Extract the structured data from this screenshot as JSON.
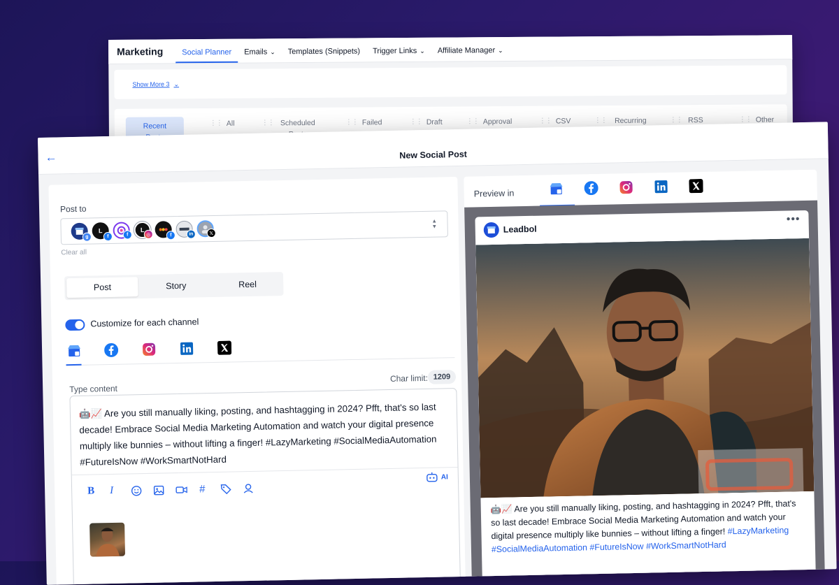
{
  "marketing": {
    "brand": "Marketing",
    "nav": [
      {
        "label": "Social Planner",
        "active": true,
        "dropdown": false
      },
      {
        "label": "Emails",
        "active": false,
        "dropdown": true
      },
      {
        "label": "Templates (Snippets)",
        "active": false,
        "dropdown": false
      },
      {
        "label": "Trigger Links",
        "active": false,
        "dropdown": true
      },
      {
        "label": "Affiliate Manager",
        "active": false,
        "dropdown": true
      }
    ],
    "show_more": "Show More 3",
    "post_tabs": [
      {
        "label": "Recent Posts",
        "active": true
      },
      {
        "label": "All",
        "active": false
      },
      {
        "label": "Scheduled Posts",
        "active": false
      },
      {
        "label": "Failed",
        "active": false
      },
      {
        "label": "Draft",
        "active": false
      },
      {
        "label": "Approval",
        "active": false
      },
      {
        "label": "CSV",
        "active": false
      },
      {
        "label": "Recurring Posts",
        "active": false
      },
      {
        "label": "RSS Posts",
        "active": false
      },
      {
        "label": "Other",
        "active": false
      }
    ]
  },
  "new_post": {
    "title": "New Social Post",
    "post_to_label": "Post to",
    "clear_all": "Clear all",
    "accounts": [
      {
        "initial": "",
        "network": "google-business",
        "bg": "#1e3a8a"
      },
      {
        "initial": "L",
        "network": "facebook",
        "bg": "#111111"
      },
      {
        "initial": "",
        "network": "facebook",
        "bg": "#7c3aed"
      },
      {
        "initial": "L",
        "network": "instagram",
        "bg": "#111111"
      },
      {
        "initial": "",
        "network": "facebook",
        "bg": "#111111"
      },
      {
        "initial": "",
        "network": "linkedin",
        "bg": "#e5e7eb"
      },
      {
        "initial": "",
        "network": "x",
        "bg": "#9ca3af"
      }
    ],
    "type_tabs": [
      {
        "label": "Post",
        "active": true
      },
      {
        "label": "Story",
        "active": false
      },
      {
        "label": "Reel",
        "active": false
      }
    ],
    "customize_label": "Customize for each channel",
    "customize_on": true,
    "channels": [
      "google-business-icon",
      "facebook-icon",
      "instagram-icon",
      "linkedin-icon",
      "x-icon"
    ],
    "type_content_label": "Type content",
    "char_limit_label": "Char limit:",
    "char_limit_value": "1209",
    "content": {
      "emoji": "🤖📈",
      "text": "Are you still manually liking, posting, and hashtagging in 2024? Pfft, that's so last decade! Embrace Social Media Marketing Automation and watch your digital presence multiply like bunnies – without lifting a finger! #LazyMarketing #SocialMediaAutomation #FutureIsNow #WorkSmartNotHard"
    },
    "ai_label": "AI",
    "toolbar_tools": [
      "bold-icon",
      "italic-icon",
      "emoji-icon",
      "image-icon",
      "video-icon",
      "hashtag-icon",
      "tag-icon",
      "location-icon"
    ]
  },
  "preview": {
    "label": "Preview in",
    "channels": [
      "google-business-icon",
      "facebook-icon",
      "instagram-icon",
      "linkedin-icon",
      "x-icon"
    ],
    "account_name": "Leadbol",
    "post_emoji": "🤖📈",
    "post_text": "Are you still manually liking, posting, and hashtagging in 2024? Pfft, that's so last decade! Embrace Social Media Marketing Automation and watch your digital presence multiply like bunnies – without lifting a finger!",
    "hashtags": "#LazyMarketing #SocialMediaAutomation #FutureIsNow #WorkSmartNotHard"
  },
  "colors": {
    "accent": "#2563eb",
    "facebook": "#1877f2",
    "linkedin": "#0a66c2"
  }
}
